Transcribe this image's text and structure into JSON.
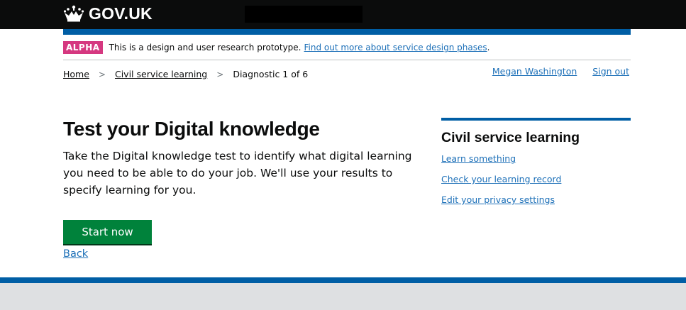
{
  "header": {
    "logo_text": "GOV.UK",
    "logo_icon": "crown-icon"
  },
  "phase_banner": {
    "tag": "ALPHA",
    "text": "This is a design and user research prototype.",
    "link": "Find out more about service design phases",
    "link_suffix": "."
  },
  "breadcrumbs": {
    "items": [
      "Home",
      "Civil service learning"
    ],
    "separator": ">",
    "current": "Diagnostic 1 of 6"
  },
  "account": {
    "user_name": "Megan Washington",
    "sign_out": "Sign out"
  },
  "main": {
    "title": "Test your Digital knowledge",
    "lead": "Take the Digital knowledge test to identify what digital learning you need to be able to do your job. We'll use your results to specify learning for you.",
    "start_button": "Start now",
    "back_link": "Back"
  },
  "sidebar": {
    "title": "Civil service learning",
    "links": [
      "Learn something",
      "Check your learning record",
      "Edit your privacy settings"
    ]
  },
  "colors": {
    "header_bg": "#0b0c0c",
    "brand_blue": "#005ea5",
    "link_blue": "#1d70b8",
    "phase_pink": "#d53880",
    "button_green": "#00823b",
    "footer_grey": "#dee0e2"
  }
}
